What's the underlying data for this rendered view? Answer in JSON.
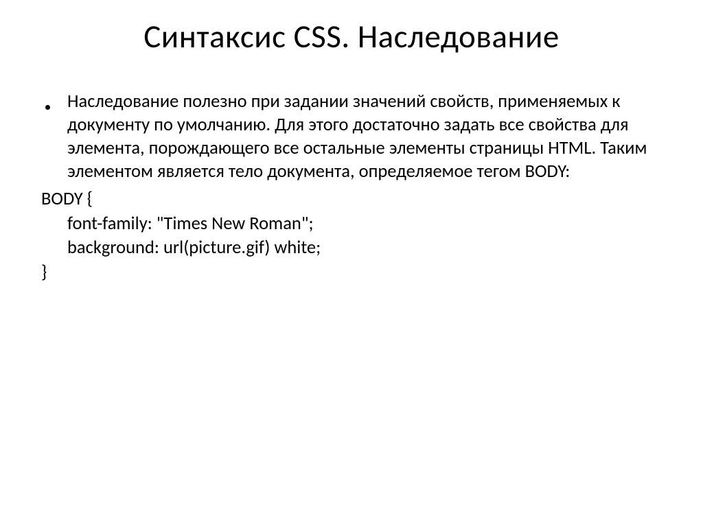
{
  "title": "Синтаксис CSS. Наследование",
  "bullet": {
    "text": "Наследование полезно при задании значений свойств, применяемых к документу по умолчанию. Для этого достаточно задать все свойства для элемента, порождающего все остальные элементы страницы HTML. Таким элементом является тело документа, определяемое тегом BODY:"
  },
  "code": {
    "line1": "BODY {",
    "line2": "font-family: \"Times New Roman\";",
    "line3": "background:  url(picture.gif) white;",
    "line4": "}"
  }
}
